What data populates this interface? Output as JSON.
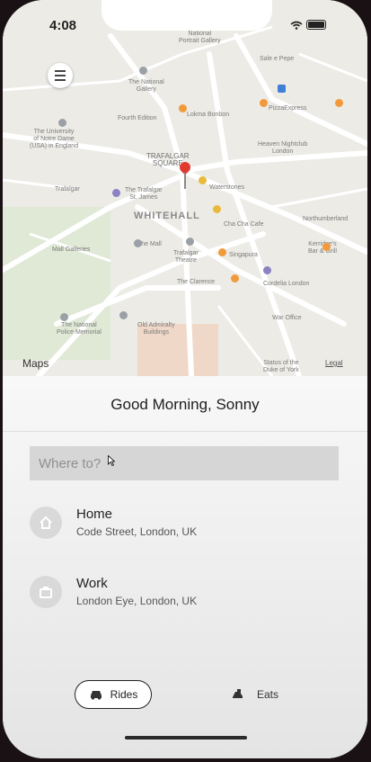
{
  "status": {
    "time": "4:08"
  },
  "map": {
    "labels": {
      "gallery": "The National\nGallery",
      "university": "The University\nof Notre Dame\n(USA) in England",
      "trafalgar": "TRAFALGAR\nSQUARE",
      "whitehall": "WHITEHALL",
      "trafalgar_theatre": "Trafalgar\nTheatre",
      "national_police": "The National\nPolice Memorial",
      "old_admiralty": "Old Admiralty\nBuildings",
      "mall_galleries": "Mall Galleries",
      "waterstones": "Waterstones",
      "singapura": "Singapura",
      "the_clarence": "The Clarence",
      "northumberland": "Northumberland",
      "lokma": "Lokma Bonbon",
      "pizza_express": "PizzaExpress",
      "cordelia": "Cordelia London",
      "trafalgar_st": "The Trafalgar\nSt. James",
      "fourth_edition": "Fourth Edition",
      "the_mall": "The Mall",
      "heaven": "Heaven Nightclub\nLondon",
      "status_duke": "Status of the\nDuke of York",
      "war_office": "War Office",
      "kerridges": "Kerridge's\nBar & Grill",
      "cbd_cafe": "Cha Cha Cafe",
      "sale_pepe": "Sale e Pepe",
      "national_portrait": "National\nPortrait Gallery",
      "tr_22": "Trafalgar"
    },
    "attribution": "Maps",
    "legal": "Legal"
  },
  "sheet": {
    "greeting": "Good Morning, Sonny",
    "search_placeholder": "Where to?",
    "places": [
      {
        "title": "Home",
        "subtitle": "Code Street, London, UK"
      },
      {
        "title": "Work",
        "subtitle": "London Eye, London, UK"
      }
    ],
    "nav": {
      "rides": "Rides",
      "eats": "Eats"
    }
  }
}
